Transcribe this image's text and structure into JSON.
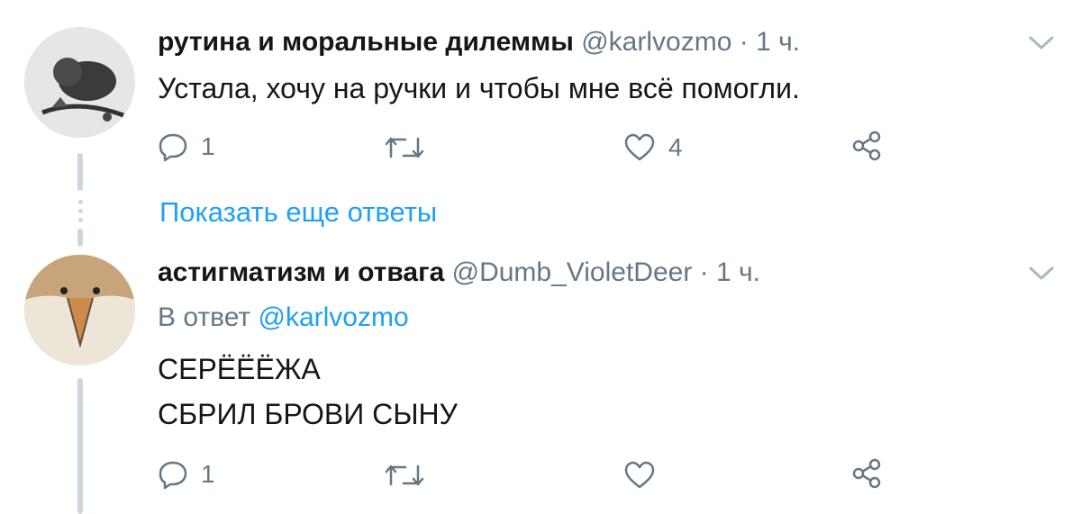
{
  "tweets": [
    {
      "name": "рутина и моральные дилеммы",
      "handle": "@karlvozmo",
      "separator": "·",
      "time": "1 ч.",
      "text": "Устала, хочу на ручки и чтобы мне всё помогли.",
      "actions": {
        "reply_count": "1",
        "retweet_count": "",
        "like_count": "4"
      }
    },
    {
      "name": "астигматизм и отвага",
      "handle": "@Dumb_VioletDeer",
      "separator": "·",
      "time": "1 ч.",
      "reply_prefix": "В ответ",
      "reply_mention": "@karlvozmo",
      "text_lines": [
        "СЕРЁЁЁЖА",
        "СБРИЛ БРОВИ СЫНУ"
      ],
      "actions": {
        "reply_count": "1",
        "retweet_count": "",
        "like_count": ""
      }
    }
  ],
  "show_more_replies": "Показать еще ответы",
  "colors": {
    "link": "#1da1f2",
    "muted": "#657786",
    "text": "#14171a",
    "thread_line": "#ccd6dd"
  },
  "icons": [
    "reply-icon",
    "retweet-icon",
    "like-icon",
    "share-icon",
    "chevron-down-icon"
  ]
}
